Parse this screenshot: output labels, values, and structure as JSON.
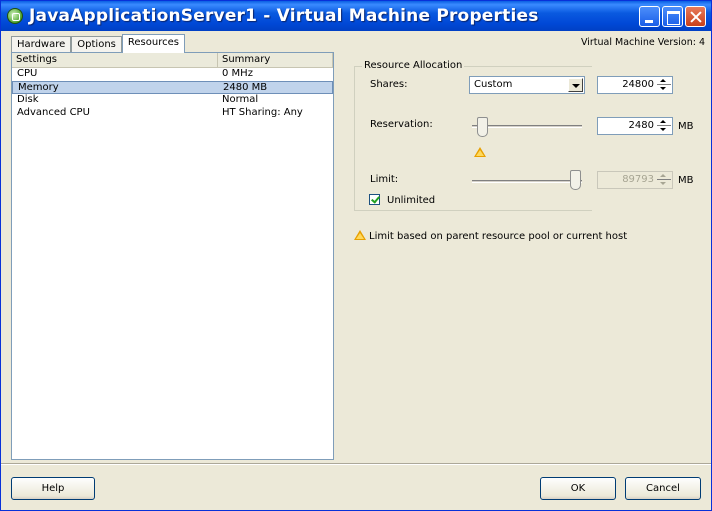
{
  "window": {
    "title": "JavaApplicationServer1 - Virtual Machine Properties",
    "vm_version": "Virtual Machine Version: 4"
  },
  "tabs": [
    {
      "label": "Hardware",
      "active": false
    },
    {
      "label": "Options",
      "active": false
    },
    {
      "label": "Resources",
      "active": true
    }
  ],
  "settings_list": {
    "headers": [
      "Settings",
      "Summary"
    ],
    "rows": [
      {
        "setting": "CPU",
        "summary": "0 MHz",
        "selected": false
      },
      {
        "setting": "Memory",
        "summary": "2480 MB",
        "selected": true
      },
      {
        "setting": "Disk",
        "summary": "Normal",
        "selected": false
      },
      {
        "setting": "Advanced CPU",
        "summary": "HT Sharing: Any",
        "selected": false
      }
    ]
  },
  "resource_allocation": {
    "group_title": "Resource Allocation",
    "shares_label": "Shares:",
    "shares_option": "Custom",
    "shares_value": "24800",
    "reservation_label": "Reservation:",
    "reservation_value": "2480",
    "reservation_unit": "MB",
    "limit_label": "Limit:",
    "limit_value": "89793",
    "limit_unit": "MB",
    "unlimited_label": "Unlimited",
    "unlimited_checked": true
  },
  "warning_note": "Limit based on parent resource pool or current host",
  "buttons": {
    "help": "Help",
    "ok": "OK",
    "cancel": "Cancel"
  },
  "colors": {
    "titlebar": "#0a5ae0",
    "selection": "#c0d3eb",
    "warning": "#e8a000"
  },
  "icons": {
    "title": "vm-icon",
    "warning": "warning-triangle-icon"
  }
}
